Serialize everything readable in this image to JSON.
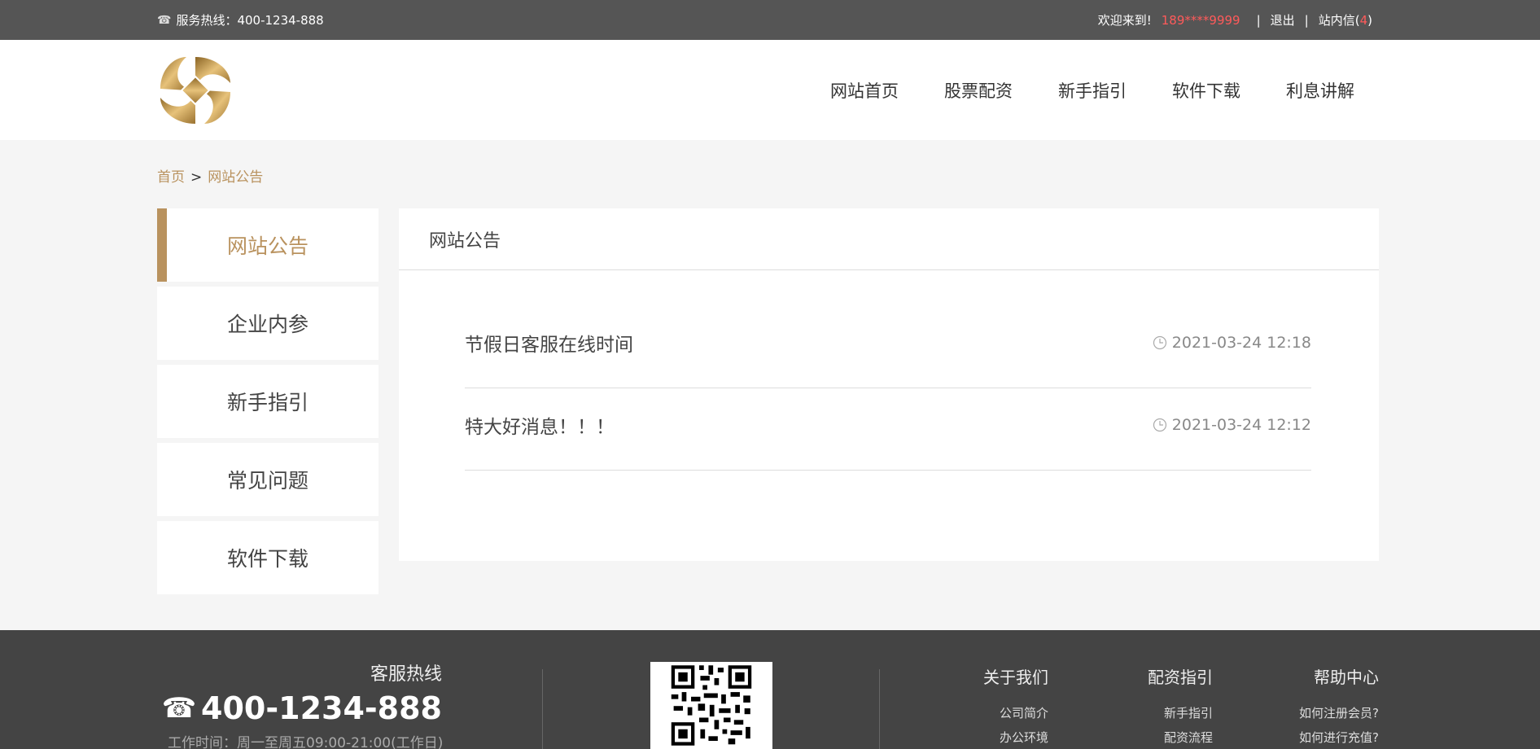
{
  "topbar": {
    "hotline_label": "服务热线：",
    "hotline_number": "400-1234-888",
    "welcome": "欢迎来到!",
    "phone": "189****9999",
    "separator": "|",
    "logout": "退出",
    "inbox_label": "站内信",
    "inbox_open": "(",
    "inbox_count": "4",
    "inbox_close": ")"
  },
  "nav": {
    "items": [
      "网站首页",
      "股票配资",
      "新手指引",
      "软件下载",
      "利息讲解"
    ]
  },
  "breadcrumb": {
    "home": "首页",
    "separator": ">",
    "current": "网站公告"
  },
  "sidebar": {
    "items": [
      "网站公告",
      "企业内参",
      "新手指引",
      "常见问题",
      "软件下载"
    ],
    "active_index": 0
  },
  "panel": {
    "title": "网站公告",
    "notices": [
      {
        "title": "节假日客服在线时间",
        "time": "2021-03-24 12:18"
      },
      {
        "title": "特大好消息！！！",
        "time": "2021-03-24 12:12"
      }
    ]
  },
  "footer": {
    "hotline_label": "客服热线",
    "hotline_number": "400-1234-888",
    "worktime": "工作时间：周一至周五09:00-21:00(工作日)",
    "columns": [
      {
        "title": "关于我们",
        "links": [
          "公司简介",
          "办公环境"
        ]
      },
      {
        "title": "配资指引",
        "links": [
          "新手指引",
          "配资流程"
        ]
      },
      {
        "title": "帮助中心",
        "links": [
          "如何注册会员?",
          "如何进行充值?"
        ]
      }
    ]
  },
  "colors": {
    "accent": "#b9925e",
    "highlight": "#ff5a5a",
    "topbar_bg": "#555555",
    "footer_bg": "#444444"
  },
  "icons": {
    "hotline": "phone-icon",
    "notice_time": "clock-icon",
    "footer_hotline": "phone-icon"
  }
}
